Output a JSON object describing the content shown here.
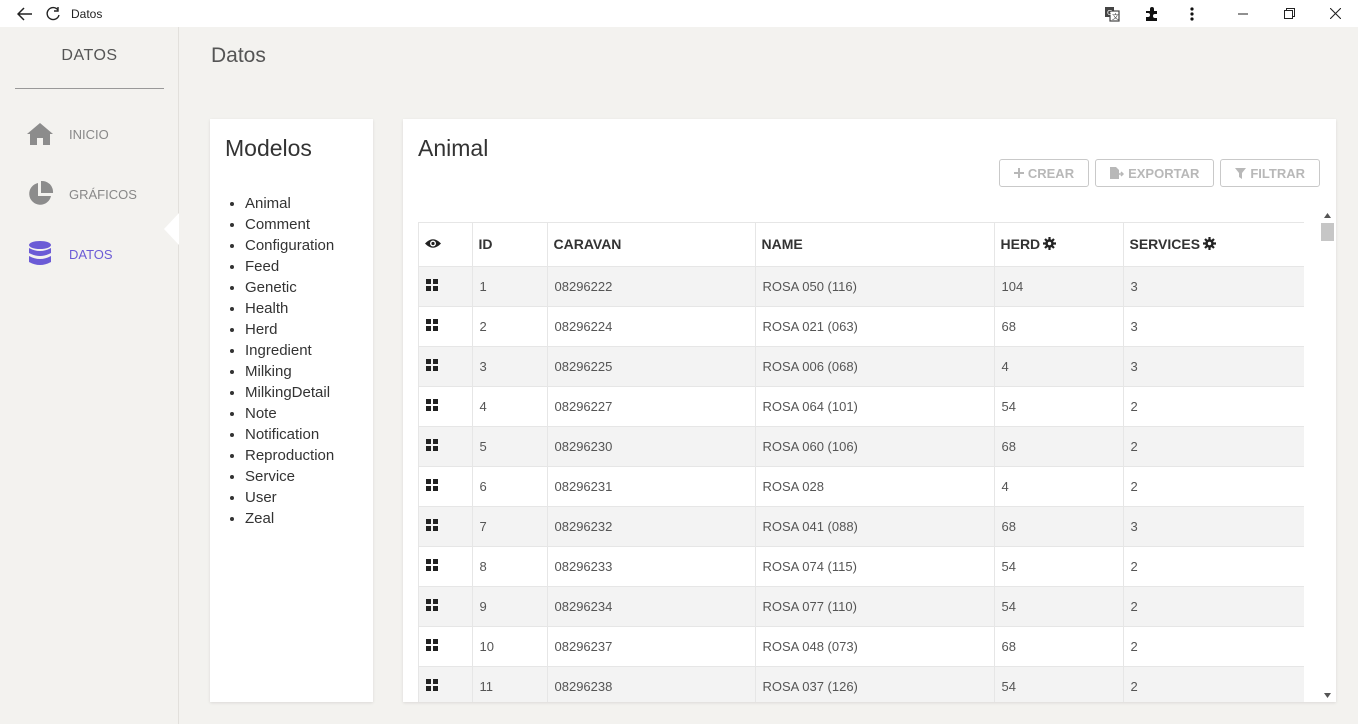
{
  "window": {
    "title": "Datos",
    "back_icon": "arrow-left-icon",
    "reload_icon": "refresh-icon"
  },
  "sidebar": {
    "brand": "DATOS",
    "items": [
      {
        "label": "INICIO",
        "icon": "home-icon",
        "active": false
      },
      {
        "label": "GRÁFICOS",
        "icon": "pie-chart-icon",
        "active": false
      },
      {
        "label": "DATOS",
        "icon": "database-icon",
        "active": true
      }
    ],
    "accent": "#6b5bd6"
  },
  "page": {
    "title": "Datos"
  },
  "models": {
    "title": "Modelos",
    "items": [
      "Animal",
      "Comment",
      "Configuration",
      "Feed",
      "Genetic",
      "Health",
      "Herd",
      "Ingredient",
      "Milking",
      "MilkingDetail",
      "Note",
      "Notification",
      "Reproduction",
      "Service",
      "User",
      "Zeal"
    ]
  },
  "animal": {
    "title": "Animal",
    "actions": {
      "create": "CREAR",
      "export": "EXPORTAR",
      "filter": "FILTRAR"
    },
    "columns": [
      "ID",
      "CARAVAN",
      "NAME",
      "HERD",
      "SERVICES"
    ],
    "rows": [
      [
        "1",
        "08296222",
        "ROSA 050 (116)",
        "104",
        "3"
      ],
      [
        "2",
        "08296224",
        "ROSA 021 (063)",
        "68",
        "3"
      ],
      [
        "3",
        "08296225",
        "ROSA 006 (068)",
        "4",
        "3"
      ],
      [
        "4",
        "08296227",
        "ROSA 064 (101)",
        "54",
        "2"
      ],
      [
        "5",
        "08296230",
        "ROSA 060 (106)",
        "68",
        "2"
      ],
      [
        "6",
        "08296231",
        "ROSA 028",
        "4",
        "2"
      ],
      [
        "7",
        "08296232",
        "ROSA 041 (088)",
        "68",
        "3"
      ],
      [
        "8",
        "08296233",
        "ROSA 074 (115)",
        "54",
        "2"
      ],
      [
        "9",
        "08296234",
        "ROSA 077 (110)",
        "54",
        "2"
      ],
      [
        "10",
        "08296237",
        "ROSA 048 (073)",
        "68",
        "2"
      ],
      [
        "11",
        "08296238",
        "ROSA 037 (126)",
        "54",
        "2"
      ]
    ]
  }
}
